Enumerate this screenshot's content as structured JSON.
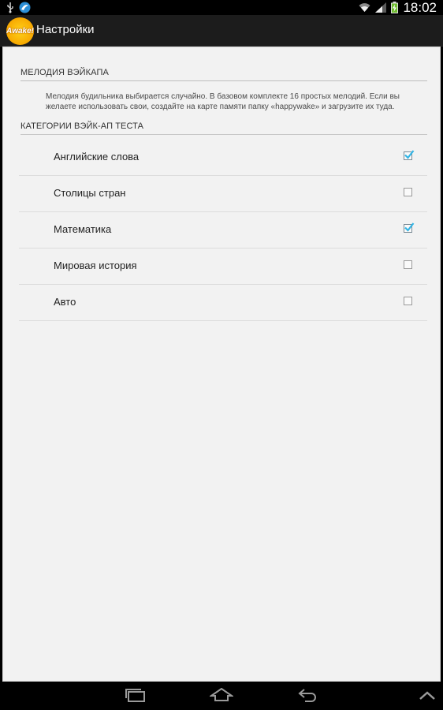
{
  "status_bar": {
    "time": "18:02",
    "icons": [
      "usb-icon",
      "notification-icon",
      "wifi-icon",
      "signal-icon",
      "battery-charging-icon"
    ]
  },
  "action_bar": {
    "logo_text": "Awake!",
    "title": "Настройки"
  },
  "melody_section": {
    "header": "МЕЛОДИЯ ВЭЙКАПА",
    "description": "Мелодия будильника выбирается случайно. В базовом комплекте 16 простых мелодий. Если вы желаете использовать свои, создайте на карте памяти папку «happywake» и загрузите их туда."
  },
  "categories_section": {
    "header": "КАТЕГОРИИ ВЭЙК-АП ТЕСТА",
    "items": [
      {
        "label": "Английские слова",
        "checked": true
      },
      {
        "label": "Столицы стран",
        "checked": false
      },
      {
        "label": "Математика",
        "checked": true
      },
      {
        "label": "Мировая история",
        "checked": false
      },
      {
        "label": "Авто",
        "checked": false
      }
    ]
  },
  "nav_bar": {
    "icons": [
      "recent-apps-icon",
      "home-icon",
      "back-icon",
      "menu-up-icon"
    ]
  },
  "colors": {
    "accent_check": "#33b5e5",
    "background": "#f2f2f2",
    "action_bar": "#1c1c1c"
  }
}
